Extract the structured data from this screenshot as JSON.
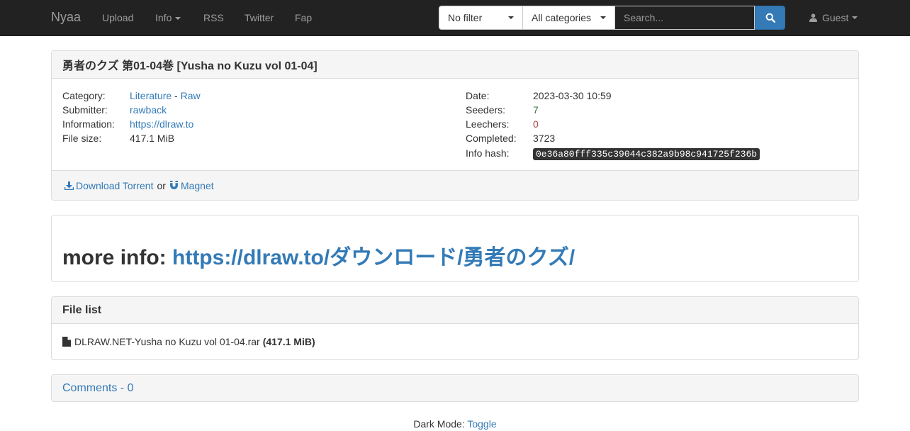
{
  "navbar": {
    "brand": "Nyaa",
    "upload": "Upload",
    "info": "Info",
    "rss": "RSS",
    "twitter": "Twitter",
    "fap": "Fap",
    "filter_selected": "No filter",
    "category_selected": "All categories",
    "search_placeholder": "Search...",
    "user": "Guest"
  },
  "torrent": {
    "title": "勇者のクズ 第01-04巻 [Yusha no Kuzu vol 01-04]",
    "category_label": "Category:",
    "category_main": "Literature",
    "category_sep": " - ",
    "category_sub": "Raw",
    "submitter_label": "Submitter:",
    "submitter": "rawback",
    "information_label": "Information:",
    "information": "https://dlraw.to",
    "filesize_label": "File size:",
    "filesize": "417.1 MiB",
    "date_label": "Date:",
    "date": "2023-03-30 10:59",
    "seeders_label": "Seeders:",
    "seeders": "7",
    "leechers_label": "Leechers:",
    "leechers": "0",
    "completed_label": "Completed:",
    "completed": "3723",
    "infohash_label": "Info hash:",
    "infohash": "0e36a80fff335c39044c382a9b98c941725f236b",
    "download_label": "Download Torrent",
    "or": "or",
    "magnet_label": "Magnet"
  },
  "description": {
    "prefix": "more info: ",
    "link": "https://dlraw.to/ダウンロード/勇者のクズ/"
  },
  "filelist": {
    "heading": "File list",
    "file_name": "DLRAW.NET-Yusha no Kuzu vol 01-04.rar",
    "file_size": "(417.1 MiB)"
  },
  "comments": {
    "heading": "Comments - 0"
  },
  "footer": {
    "dark_mode_label": "Dark Mode:",
    "toggle": "Toggle"
  },
  "colors": {
    "navbar": "#222222",
    "link": "#337ab7",
    "seeders": "#3c763d",
    "leechers": "#a94442"
  }
}
